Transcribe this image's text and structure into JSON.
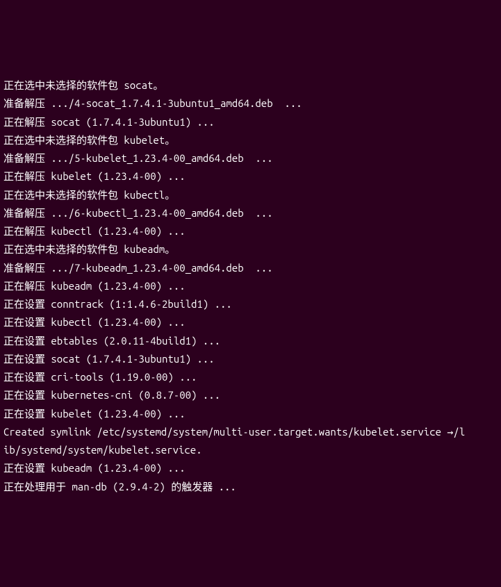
{
  "lines": [
    "正在选中未选择的软件包 socat。",
    "准备解压 .../4-socat_1.7.4.1-3ubuntu1_amd64.deb  ...",
    "正在解压 socat (1.7.4.1-3ubuntu1) ...",
    "正在选中未选择的软件包 kubelet。",
    "准备解压 .../5-kubelet_1.23.4-00_amd64.deb  ...",
    "正在解压 kubelet (1.23.4-00) ...",
    "正在选中未选择的软件包 kubectl。",
    "准备解压 .../6-kubectl_1.23.4-00_amd64.deb  ...",
    "正在解压 kubectl (1.23.4-00) ...",
    "正在选中未选择的软件包 kubeadm。",
    "准备解压 .../7-kubeadm_1.23.4-00_amd64.deb  ...",
    "正在解压 kubeadm (1.23.4-00) ...",
    "正在设置 conntrack (1:1.4.6-2build1) ...",
    "正在设置 kubectl (1.23.4-00) ...",
    "正在设置 ebtables (2.0.11-4build1) ...",
    "正在设置 socat (1.7.4.1-3ubuntu1) ...",
    "正在设置 cri-tools (1.19.0-00) ...",
    "正在设置 kubernetes-cni (0.8.7-00) ...",
    "正在设置 kubelet (1.23.4-00) ...",
    "Created symlink /etc/systemd/system/multi-user.target.wants/kubelet.service →/l",
    "ib/systemd/system/kubelet.service.",
    "正在设置 kubeadm (1.23.4-00) ...",
    "正在处理用于 man-db (2.9.4-2) 的触发器 ..."
  ]
}
